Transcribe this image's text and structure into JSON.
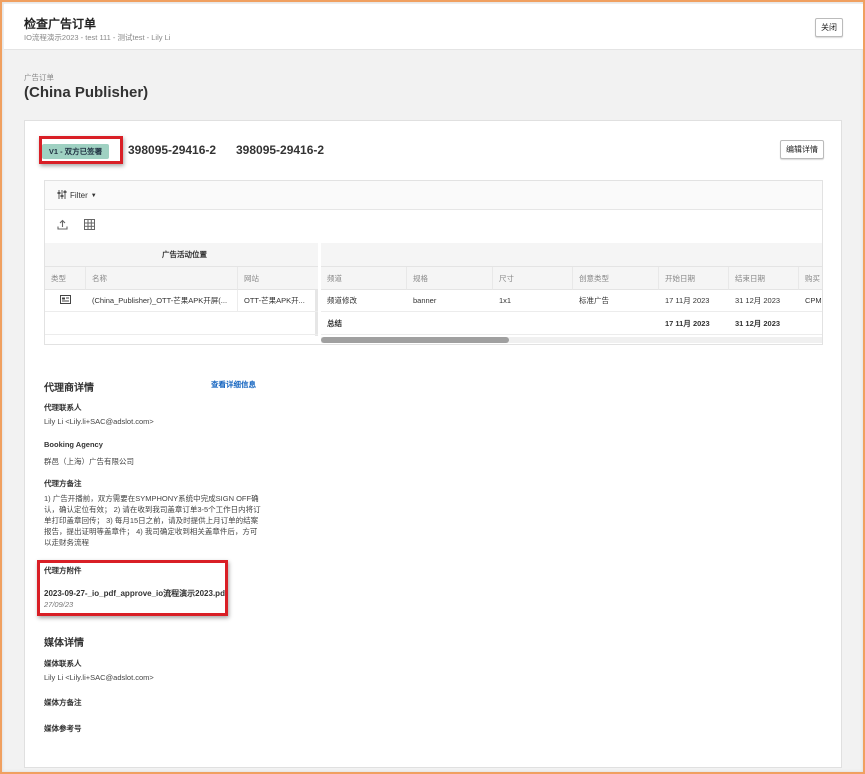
{
  "header": {
    "title": "检查广告订单",
    "subtitle": "IO流程演示2023 - test 111 - 测试test - Lily Li",
    "close_label": "关闭"
  },
  "page": {
    "breadcrumb": "广告订单",
    "title": "(China Publisher)"
  },
  "order": {
    "status": "V1 - 双方已签署",
    "id_primary": "398095-29416-2",
    "id_secondary": "398095-29416-2",
    "edit_label": "编辑详情"
  },
  "grid": {
    "filter_label": "Filter",
    "left_group_header": "广告活动位置",
    "left_columns": [
      "类型",
      "名称",
      "网站"
    ],
    "left_row": [
      "",
      "(China_Publisher)_OTT-芒果APK开屏(...",
      "OTT-芒果APK开..."
    ],
    "right_columns": [
      "频道",
      "规格",
      "尺寸",
      "创意类型",
      "开始日期",
      "结束日期",
      "购买"
    ],
    "right_row": [
      "频道修改",
      "banner",
      "1x1",
      "标准广告",
      "17 11月 2023",
      "31 12月 2023",
      "CPM"
    ],
    "total_row": [
      "总结",
      "",
      "",
      "",
      "17 11月 2023",
      "31 12月 2023",
      ""
    ]
  },
  "agency": {
    "section_title": "代理商详情",
    "view_details_link": "查看详细信息",
    "contact_label": "代理联系人",
    "contact_value": "Lily Li <Lily.li+SAC@adslot.com>",
    "booking_label": "Booking Agency",
    "booking_value": "群邑（上海）广告有限公司",
    "notes_label": "代理方备注",
    "notes_value": "1) 广告开播前，双方需要在SYMPHONY系统中完成SIGN OFF确认，确认定位有效； 2) 请在收到我司盖章订单3-5个工作日内将订单打印盖章回传； 3) 每月15日之前，请及时提供上月订单的结案报告，提出证明等盖章件； 4) 我司确定收到相关盖章件后，方可以走财务流程",
    "attachment_label": "代理方附件",
    "attachment_file": "2023-09-27-_io_pdf_approve_io流程演示2023.pdf",
    "attachment_date": "27/09/23"
  },
  "media": {
    "section_title": "媒体详情",
    "contact_label": "媒体联系人",
    "contact_value": "Lily Li <Lily.li+SAC@adslot.com>",
    "notes_label": "媒体方备注",
    "reference_label": "媒体参考号"
  },
  "colors": {
    "status_badge": "#9fd1c2",
    "highlight_box": "#d91f26",
    "link": "#1565c0",
    "frame_border": "#f0a060"
  }
}
